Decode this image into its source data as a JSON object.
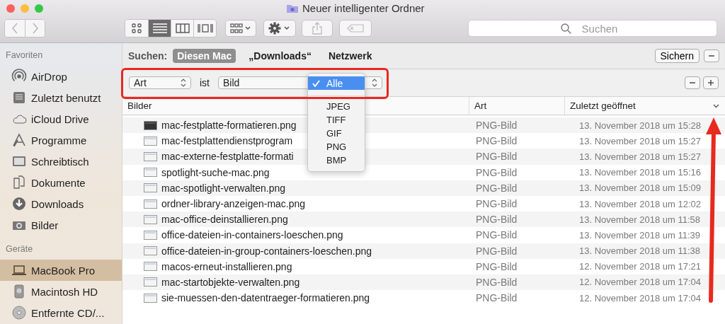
{
  "window": {
    "title": "Neuer intelligenter Ordner"
  },
  "toolbar": {
    "view_modes": [
      {
        "kind": "icons",
        "selected": false
      },
      {
        "kind": "list",
        "selected": true
      },
      {
        "kind": "columns",
        "selected": false
      },
      {
        "kind": "gallery",
        "selected": false
      }
    ],
    "search": {
      "placeholder": "Suchen"
    }
  },
  "sidebar": {
    "sections": [
      {
        "title": "Favoriten",
        "items": [
          {
            "label": "AirDrop",
            "selected": false
          },
          {
            "label": "Zuletzt benutzt",
            "selected": false
          },
          {
            "label": "iCloud Drive",
            "selected": false
          },
          {
            "label": "Programme",
            "selected": false
          },
          {
            "label": "Schreibtisch",
            "selected": false
          },
          {
            "label": "Dokumente",
            "selected": false
          },
          {
            "label": "Downloads",
            "selected": false
          },
          {
            "label": "Bilder",
            "selected": false
          }
        ]
      },
      {
        "title": "Geräte",
        "items": [
          {
            "label": "MacBook Pro",
            "selected": true
          },
          {
            "label": "Macintosh HD",
            "selected": false
          },
          {
            "label": "Entfernte CD/...",
            "selected": false
          }
        ]
      }
    ]
  },
  "search_bar": {
    "label": "Suchen:",
    "scopes": [
      {
        "label": "Diesen Mac",
        "selected": true
      },
      {
        "label": "„Downloads“",
        "selected": false
      },
      {
        "label": "Netzwerk",
        "selected": false
      }
    ],
    "save": "Sichern"
  },
  "criteria": {
    "attribute": "Art",
    "operator": "ist",
    "value": "Bild",
    "menu": [
      {
        "label": "Alle",
        "selected": true
      },
      {
        "label": "JPEG",
        "selected": false
      },
      {
        "label": "TIFF",
        "selected": false
      },
      {
        "label": "GIF",
        "selected": false
      },
      {
        "label": "PNG",
        "selected": false
      },
      {
        "label": "BMP",
        "selected": false
      }
    ]
  },
  "table": {
    "columns": [
      "Bilder",
      "Art",
      "Zuletzt geöffnet"
    ],
    "rows": [
      {
        "name": "mac-festplatte-formatieren.png",
        "type": "PNG-Bild",
        "opened": "13. November 2018 um 15:28"
      },
      {
        "name": "mac-festplattendienstprogram",
        "type": "PNG-Bild",
        "opened": "13. November 2018 um 15:27"
      },
      {
        "name": "mac-externe-festplatte-formati",
        "type": "PNG-Bild",
        "opened": "13. November 2018 um 15:27"
      },
      {
        "name": "spotlight-suche-mac.png",
        "type": "PNG-Bild",
        "opened": "13. November 2018 um 15:16"
      },
      {
        "name": "mac-spotlight-verwalten.png",
        "type": "PNG-Bild",
        "opened": "13. November 2018 um 15:09"
      },
      {
        "name": "ordner-library-anzeigen-mac.png",
        "type": "PNG-Bild",
        "opened": "13. November 2018 um 12:02"
      },
      {
        "name": "mac-office-deinstallieren.png",
        "type": "PNG-Bild",
        "opened": "13. November 2018 um 11:58"
      },
      {
        "name": "office-dateien-in-containers-loeschen.png",
        "type": "PNG-Bild",
        "opened": "13. November 2018 um 11:39"
      },
      {
        "name": "office-dateien-in-group-containers-loeschen.png",
        "type": "PNG-Bild",
        "opened": "13. November 2018 um 11:38"
      },
      {
        "name": "macos-erneut-installieren.png",
        "type": "PNG-Bild",
        "opened": "12. November 2018 um 17:21"
      },
      {
        "name": "mac-startobjekte-verwalten.png",
        "type": "PNG-Bild",
        "opened": "12. November 2018 um 17:04"
      },
      {
        "name": "sie-muessen-den-datentraeger-formatieren.png",
        "type": "PNG-Bild",
        "opened": "12. November 2018 um 17:04"
      }
    ]
  }
}
